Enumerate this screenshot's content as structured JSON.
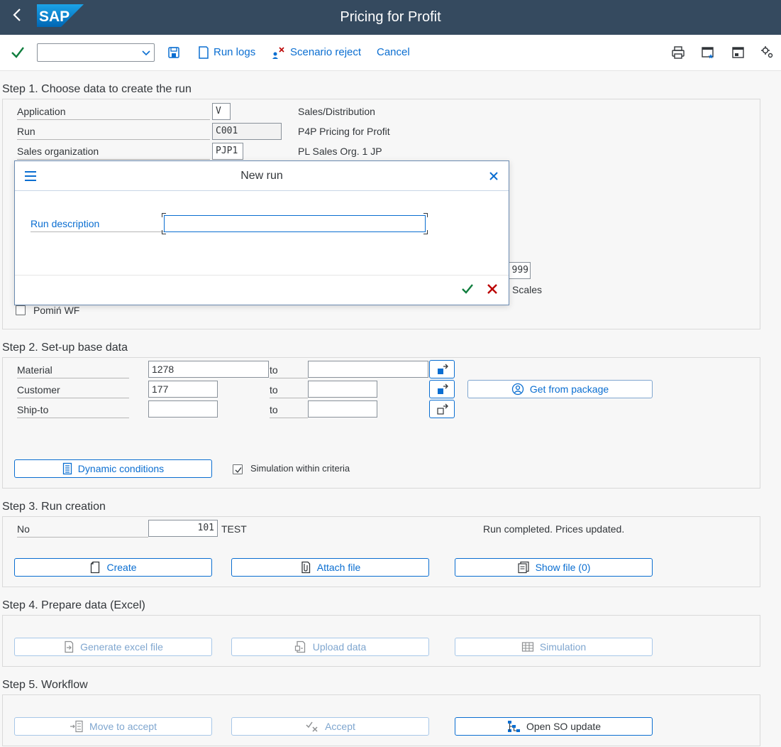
{
  "shell": {
    "title": "Pricing for Profit",
    "logo_text": "SAP"
  },
  "toolbar": {
    "command_value": "",
    "run_logs": "Run logs",
    "scenario_reject": "Scenario reject",
    "cancel": "Cancel"
  },
  "step1": {
    "title": "Step 1. Choose data to create the run",
    "application_label": "Application",
    "application_value": "V",
    "application_desc": "Sales/Distribution",
    "run_label": "Run",
    "run_value": "C001",
    "run_desc": "P4P Pricing for Profit",
    "sales_org_label": "Sales organization",
    "sales_org_value": "PJP1",
    "sales_org_desc": "PL Sales Org. 1 JP",
    "hidden_value": "999",
    "scales_label": "Scales",
    "skip_wf_label": "Pomiń WF"
  },
  "dialog": {
    "title": "New run",
    "run_description_label": "Run description",
    "run_description_value": ""
  },
  "step2": {
    "title": "Step 2. Set-up base data",
    "material_label": "Material",
    "material_from": "1278",
    "material_to": "",
    "customer_label": "Customer",
    "customer_from": "177",
    "customer_to": "",
    "shipto_label": "Ship-to",
    "shipto_from": "",
    "shipto_to": "",
    "to_label": "to",
    "get_from_package": "Get from package",
    "dynamic_conditions": "Dynamic conditions",
    "simulation_within_criteria": "Simulation within criteria"
  },
  "step3": {
    "title": "Step 3. Run creation",
    "no_label": "No",
    "no_value": "101",
    "no_desc": "TEST",
    "status": "Run completed. Prices updated.",
    "create": "Create",
    "attach_file": "Attach file",
    "show_file": "Show file (0)"
  },
  "step4": {
    "title": "Step 4. Prepare data (Excel)",
    "generate_excel": "Generate excel file",
    "upload_data": "Upload data",
    "simulation": "Simulation"
  },
  "step5": {
    "title": "Step 5. Workflow",
    "move_to_accept": "Move to accept",
    "accept": "Accept",
    "open_so_update": "Open SO update"
  },
  "colors": {
    "shell": "#354a5f",
    "accent": "#0a6ed1",
    "ok": "#107e3e",
    "reject": "#bb0000"
  }
}
